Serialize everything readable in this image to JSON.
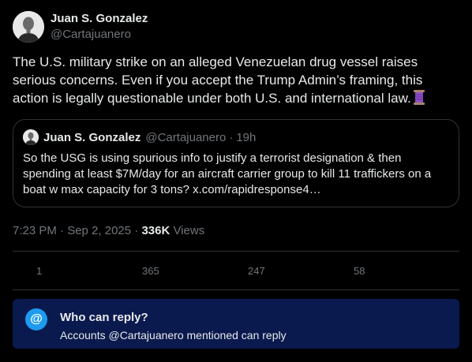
{
  "author": {
    "name": "Juan S. Gonzalez",
    "handle": "@Cartajuanero"
  },
  "tweet": {
    "text": "The U.S. military strike on an alleged Venezuelan drug vessel raises serious concerns. Even if you accept the Trump Admin’s framing, this action is legally questionable under both U.S. and international law.",
    "emoji": "thread-spool-icon"
  },
  "quote": {
    "name": "Juan S. Gonzalez",
    "handle": "@Cartajuanero",
    "separator": "·",
    "time": "19h",
    "text": "So the USG is using spurious info to justify a terrorist designation & then spending at least $7M/day for an aircraft carrier group to kill 11 traffickers on a boat w max capacity for 3 tons? x.com/rapidresponse4…"
  },
  "meta": {
    "timestamp": "7:23 PM · Sep 2, 2025 · ",
    "views_count": "336K",
    "views_label": " Views"
  },
  "actions": {
    "replies": "1",
    "reposts": "365",
    "likes": "247",
    "bookmarks": "58"
  },
  "reply_settings": {
    "icon": "@",
    "title": "Who can reply?",
    "description": "Accounts @Cartajuanero mentioned can reply"
  },
  "colors": {
    "background": "#000000",
    "text": "#e7e9ea",
    "muted": "#71767b",
    "border": "#2f3336",
    "accent": "#1d9bf0",
    "reply_box": "#0a1a4e"
  }
}
